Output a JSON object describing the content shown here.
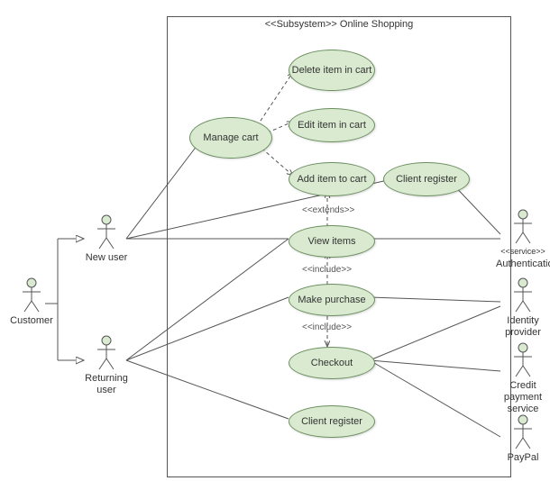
{
  "system": {
    "stereotype": "<<Subsystem>> Online Shopping"
  },
  "actors": {
    "customer": "Customer",
    "newUser": "New user",
    "returning": "Returning user",
    "auth": {
      "stereo": "<<service>>",
      "name": "Authentication"
    },
    "idp": "Identity provider",
    "credit": "Credit payment service",
    "paypal": "PayPal"
  },
  "usecases": {
    "manageCart": "Manage cart",
    "deleteItem": "Delete item in cart",
    "editItem": "Edit item in cart",
    "addItem": "Add item to cart",
    "clientReg1": "Client register",
    "viewItems": "View items",
    "makePurchase": "Make purchase",
    "checkout": "Checkout",
    "clientReg2": "Client register"
  },
  "rel": {
    "extends": "<<extends>>",
    "include1": "<<include>>",
    "include2": "<<include>>"
  }
}
